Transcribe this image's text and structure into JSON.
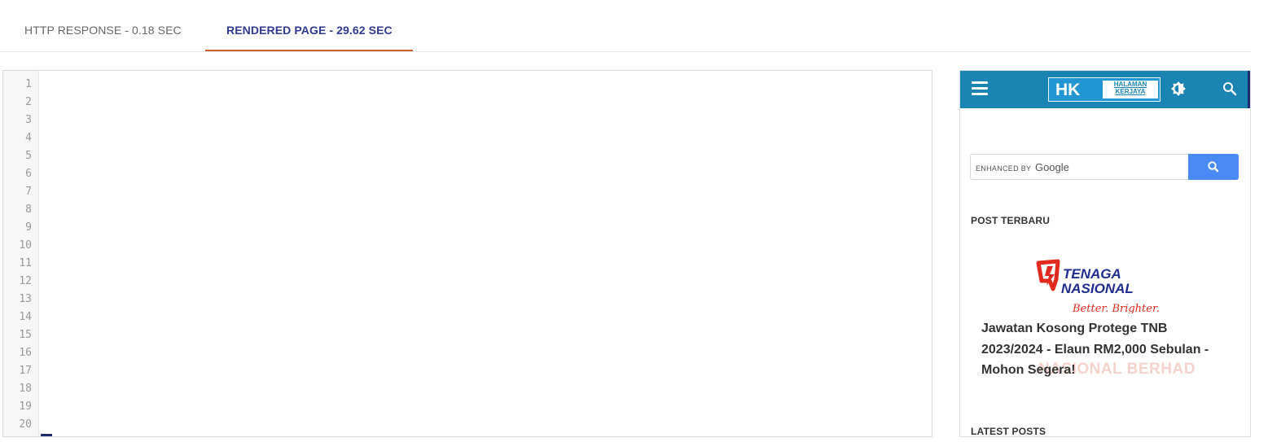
{
  "tabs": {
    "http_response": "HTTP RESPONSE - 0.18 SEC",
    "rendered_page": "RENDERED PAGE - 29.62 SEC"
  },
  "code": {
    "line_numbers": [
      "1",
      "2",
      "3",
      "4",
      "5",
      "6",
      "7",
      "8",
      "9",
      "10",
      "11",
      "12",
      "13",
      "14",
      "15",
      "16",
      "17",
      "18",
      "19",
      "20"
    ]
  },
  "preview": {
    "logo_hk": "HK",
    "logo_line1": "HALAMAN",
    "logo_line2": "KERJAYA",
    "search_prefix": "ENHANCED BY",
    "search_brand": "Google",
    "post_terbaru": "POST TERBARU",
    "thumb_brand_line1": "TENAGA",
    "thumb_brand_line2": "NASIONAL",
    "thumb_tagline": "Better. Brighter.",
    "thumb_ghost": "NASIONAL BERHAD",
    "post_title": "Jawatan Kosong Protege TNB 2023/2024 - Elaun RM2,000 Sebulan - Mohon Segera!",
    "latest_posts": "LATEST POSTS"
  },
  "colors": {
    "accent_tab": "#2f3a8f",
    "tab_underline": "#c9622f",
    "appbar": "#1a85b3",
    "search_button": "#4a8af4"
  }
}
